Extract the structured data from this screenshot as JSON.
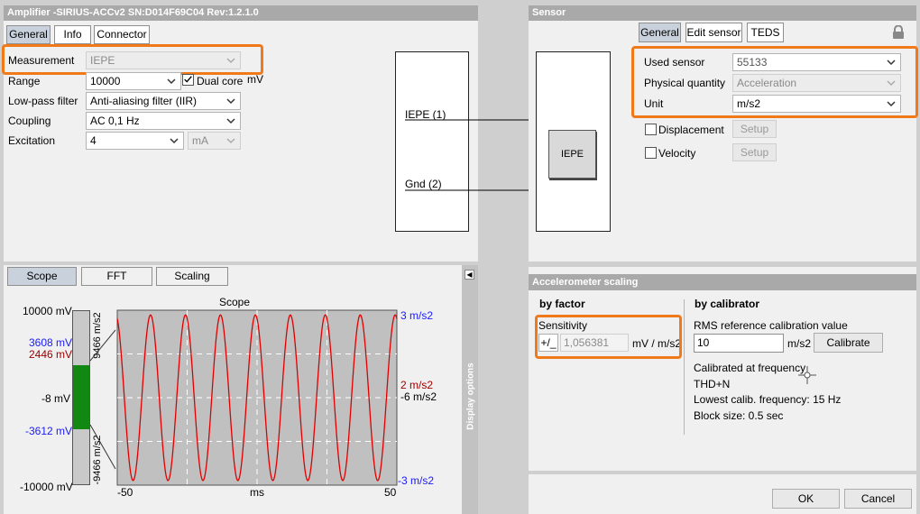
{
  "amp": {
    "title": "Amplifier -SIRIUS-ACCv2  SN:D014F69C04 Rev:1.2.1.0",
    "tabs": [
      "General",
      "Info",
      "Connector"
    ],
    "measurement_label": "Measurement",
    "measurement_value": "IEPE",
    "range_label": "Range",
    "range_value": "10000",
    "dual_core_label": "Dual core",
    "range_unit": "mV",
    "lowpass_label": "Low-pass filter",
    "lowpass_value": "Anti-aliasing filter (IIR)",
    "coupling_label": "Coupling",
    "coupling_value": "AC  0,1 Hz",
    "excitation_label": "Excitation",
    "excitation_value": "4",
    "excitation_unit": "mA"
  },
  "diagram": {
    "pin1": "IEPE (1)",
    "pin2": "Gnd (2)",
    "sensor_label": "IEPE"
  },
  "scope": {
    "tabs": [
      "Scope",
      "FFT",
      "Scaling"
    ],
    "title": "Scope",
    "left_top": "10000 mV",
    "left_blue": "3608 mV",
    "left_red": "2446 mV",
    "left_mid": "-8 mV",
    "left_blue2": "-3612 mV",
    "left_bottom": "-10000 mV",
    "bar_top": "9466 m/s2",
    "bar_bottom": "-9466 m/s2",
    "right_top": "3 m/s2",
    "right_red": "2 m/s2",
    "right_mid": "-6 m/s2",
    "right_bottom": "-3 m/s2",
    "x_left": "-50",
    "x_unit": "ms",
    "x_right": "50",
    "display_options": "Display options"
  },
  "sensor": {
    "title": "Sensor",
    "tabs": [
      "General",
      "Edit sensor",
      "TEDS"
    ],
    "used_sensor_label": "Used sensor",
    "used_sensor_value": "55133",
    "physical_quantity_label": "Physical quantity",
    "physical_quantity_value": "Acceleration",
    "unit_label": "Unit",
    "unit_value": "m/s2",
    "displacement_label": "Displacement",
    "velocity_label": "Velocity",
    "setup_label": "Setup"
  },
  "accel": {
    "title": "Accelerometer scaling",
    "by_factor": "by factor",
    "sensitivity_label": "Sensitivity",
    "plusminus": "+/_",
    "sensitivity_value": "1,056381",
    "sensitivity_unit": "mV / m/s2",
    "by_calibrator": "by calibrator",
    "rms_label": "RMS reference calibration value",
    "rms_value": "10",
    "rms_unit": "m/s2",
    "calibrate_label": "Calibrate",
    "calibrated_freq": "Calibrated at frequency",
    "thd": "THD+N",
    "lowest_freq": "Lowest calib. frequency: 15 Hz",
    "block_size": "Block size: 0.5 sec"
  },
  "dialog": {
    "ok_label": "OK",
    "cancel_label": "Cancel"
  },
  "colors": {
    "highlight": "#f07a1a",
    "signal": "#e00000",
    "blue_text": "#1a1aff",
    "red_text": "#a00000",
    "level_bar": "#118811"
  },
  "chart_data": {
    "type": "line",
    "title": "Scope",
    "xlabel": "ms",
    "x_range": [
      -50,
      50
    ],
    "y_range_mV": [
      -10000,
      10000
    ],
    "series": [
      {
        "values_desc": "sine wave",
        "frequency_hz": 80,
        "amplitude_mV": 9466,
        "offset_mV": -8
      }
    ]
  }
}
